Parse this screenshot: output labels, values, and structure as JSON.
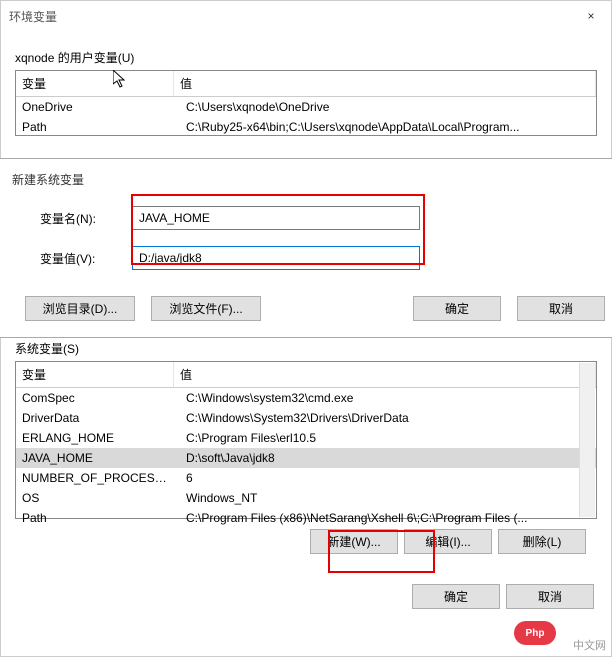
{
  "mainWindow": {
    "title": "环境变量",
    "close": "×",
    "userVarsLabel": "xqnode 的用户变量(U)",
    "colVar": "变量",
    "colVal": "值",
    "userVars": [
      {
        "name": "OneDrive",
        "value": "C:\\Users\\xqnode\\OneDrive"
      },
      {
        "name": "Path",
        "value": "C:\\Ruby25-x64\\bin;C:\\Users\\xqnode\\AppData\\Local\\Program..."
      }
    ],
    "sysVarsLabel": "系统变量(S)",
    "sysVars": [
      {
        "name": "ComSpec",
        "value": "C:\\Windows\\system32\\cmd.exe"
      },
      {
        "name": "DriverData",
        "value": "C:\\Windows\\System32\\Drivers\\DriverData"
      },
      {
        "name": "ERLANG_HOME",
        "value": "C:\\Program Files\\erl10.5"
      },
      {
        "name": "JAVA_HOME",
        "value": "D:\\soft\\Java\\jdk8",
        "selected": true
      },
      {
        "name": "NUMBER_OF_PROCESSORS",
        "value": "6"
      },
      {
        "name": "OS",
        "value": "Windows_NT"
      },
      {
        "name": "Path",
        "value": "C:\\Program Files (x86)\\NetSarang\\Xshell 6\\;C:\\Program Files (..."
      }
    ],
    "btnNew": "新建(W)...",
    "btnEdit": "编辑(I)...",
    "btnDelete": "删除(L)",
    "btnOk": "确定",
    "btnCancel": "取消"
  },
  "dialog": {
    "title": "新建系统变量",
    "nameLabel": "变量名(N):",
    "nameValue": "JAVA_HOME",
    "valueLabel": "变量值(V):",
    "valueValue": "D:/java/jdk8",
    "btnBrowseDir": "浏览目录(D)...",
    "btnBrowseFile": "浏览文件(F)...",
    "btnOk": "确定",
    "btnCancel": "取消"
  },
  "overlay": {
    "watermark": "中文网",
    "phpLogo": "Php"
  }
}
